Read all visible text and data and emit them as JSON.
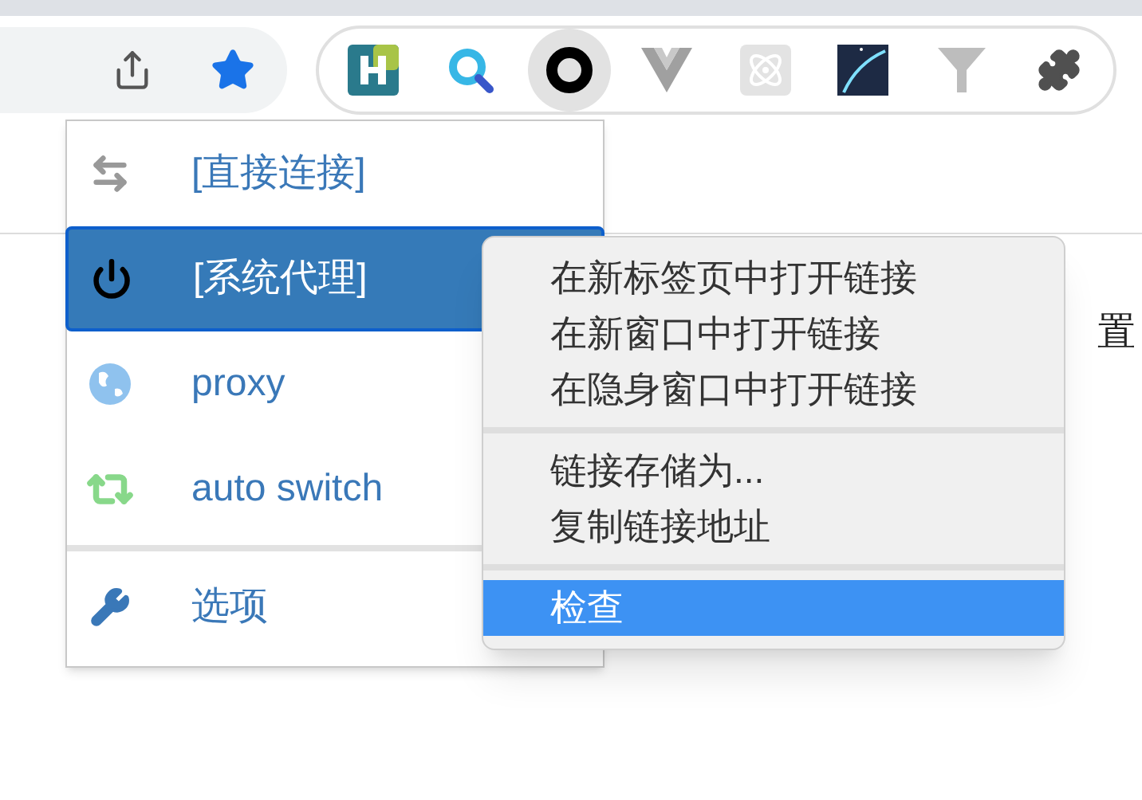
{
  "toolbar": {
    "extensions": [
      {
        "kind": "h-logo",
        "selected": false
      },
      {
        "kind": "search",
        "selected": false
      },
      {
        "kind": "ring",
        "selected": true
      },
      {
        "kind": "v-logo",
        "selected": false
      },
      {
        "kind": "atom",
        "selected": false
      },
      {
        "kind": "comet",
        "selected": false
      },
      {
        "kind": "funnel",
        "selected": false
      },
      {
        "kind": "puzzle",
        "selected": false
      }
    ]
  },
  "page": {
    "text": "置"
  },
  "popup": {
    "profiles": [
      {
        "label": "[直接连接]",
        "kind": "direct",
        "selected": false
      },
      {
        "label": "[系统代理]",
        "kind": "system",
        "selected": true
      },
      {
        "label": "proxy",
        "kind": "proxy",
        "selected": false
      },
      {
        "label": "auto switch",
        "kind": "switch",
        "selected": false
      }
    ],
    "actions": [
      {
        "label": "选项",
        "kind": "options",
        "selected": false
      }
    ]
  },
  "context_menu": {
    "groups": [
      [
        {
          "label": "在新标签页中打开链接",
          "selected": false
        },
        {
          "label": "在新窗口中打开链接",
          "selected": false
        },
        {
          "label": "在隐身窗口中打开链接",
          "selected": false
        }
      ],
      [
        {
          "label": "链接存储为...",
          "selected": false
        },
        {
          "label": "复制链接地址",
          "selected": false
        }
      ],
      [
        {
          "label": "检查",
          "selected": true
        }
      ]
    ]
  }
}
